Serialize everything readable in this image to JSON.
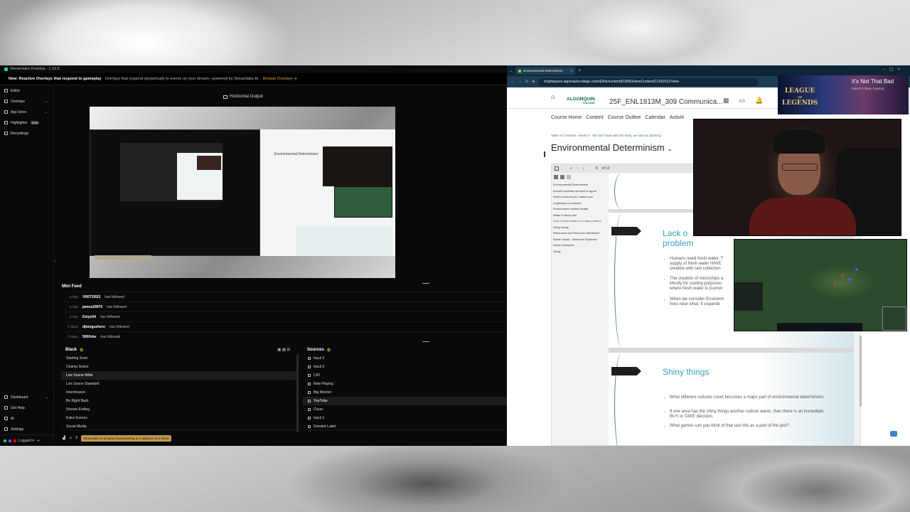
{
  "streamlabs": {
    "title": "Streamlabs Desktop - 1.19.5",
    "banner": {
      "headline": "New: Reactive Overlays that respond to gameplay",
      "text": "Overlays that respond dynamically to events on your stream—powered by Streamlabs AI.",
      "link": "Browse Overlays"
    },
    "nav": [
      {
        "label": "Editor"
      },
      {
        "label": "Overlays"
      },
      {
        "label": "App Store"
      },
      {
        "label": "Highlighter",
        "badge": "Beta"
      },
      {
        "label": "Recordings"
      }
    ],
    "nav_bottom": [
      {
        "label": "Dashboard"
      },
      {
        "label": "Get Help"
      },
      {
        "label": "AI"
      },
      {
        "label": "Settings"
      }
    ],
    "login_status": "Logged In",
    "output_label": "Horizontal Output",
    "mini_feed": {
      "title": "Mini Feed",
      "items": [
        {
          "time": "a day",
          "name": "VR0T1RS3",
          "action": "has followed"
        },
        {
          "time": "a day",
          "name": "james29975",
          "action": "has followed"
        },
        {
          "time": "a day",
          "name": "Dslye54",
          "action": "has followed"
        },
        {
          "time": "2 days",
          "name": "djtonguehero",
          "action": "has followed"
        },
        {
          "time": "3 days",
          "name": "5000zbv",
          "action": "has followed"
        }
      ]
    },
    "scenes": {
      "title": "Black",
      "items": [
        "Starting Soon",
        "Champ Select",
        "Live Scene Wide",
        "Live Scene Standard",
        "Intermission",
        "Be Right Back",
        "Stream Ending",
        "Extra Scenes",
        "Social Media"
      ],
      "selected": "Live Scene Wide"
    },
    "sources": {
      "title": "Sources",
      "items": [
        "Input 2",
        "Input 3",
        "CAT",
        "Now Playing",
        "Big Monitor",
        "YouTube",
        "Cover",
        "Input 1",
        "Donator Label"
      ],
      "selected": "YouTube"
    },
    "status": {
      "count": "5",
      "news": "Streamlabs is bringing livestreaming to AI glasses from Meta"
    }
  },
  "browser": {
    "tab_title": "Environmental Determinism",
    "url": "brightspace.algonquincollege.com/d2l/le/content/818583/viewContent/12181531/View",
    "brand": "ALGONQUIN",
    "brand_sub": "COLLEGE",
    "course_title": "25F_ENL1813M_309 Communica...",
    "nav": [
      "Course Home",
      "Content",
      "Course Outline",
      "Calendar",
      "Activiti"
    ],
    "breadcrumb": "Table of Contents  ›  Week 2 - We don't start with the story, we start by thinking  ›",
    "page_title": "Environmental Determinism",
    "page_counter": "8",
    "page_total": "of 12",
    "outline": [
      "Environmental Determinism",
      "Ancient societies seemed to agree",
      "What is around you, makes you",
      "Legitimacy to colonies",
      "Environment creates wealth",
      "Water is likely cool",
      "Lack of fresh water is a major problem",
      "Shiny things",
      "Resources and Resource distribution",
      "Easter Island - Resource Depletion",
      "Game Examples",
      "Today"
    ],
    "slide1": {
      "heading": "Lack o problem",
      "heading_line1": "Lack o",
      "heading_line2": "problem",
      "bullets": [
        "Humans need fresh water. T supply of fresh water HAVE creative with rain collection",
        "The creation of microchips a Mostly for cooling purposes where fresh water is (curren",
        "When we consider Environm lives near what. It expands"
      ]
    },
    "slide2": {
      "heading": "Shiny things",
      "bullets": [
        "What different cultures covet becomes a major part of environmental determinism.",
        "If one area has the shiny things another culture wants, then there is an immediate BUY or TAKE decision.",
        "What games can you think of that use this as a part of the plot?"
      ]
    }
  },
  "overlay": {
    "logo_line1": "LEAGUE",
    "logo_line2": "LEGENDS",
    "logo_of": "OF",
    "song_title": "It's Not That Bad",
    "song_artist": "MostCr1TiKaL Gaming"
  },
  "colors": {
    "accent_gold": "#e0a94a",
    "brand_green": "#0b6b3a",
    "slide_heading": "#3aa0b8"
  }
}
